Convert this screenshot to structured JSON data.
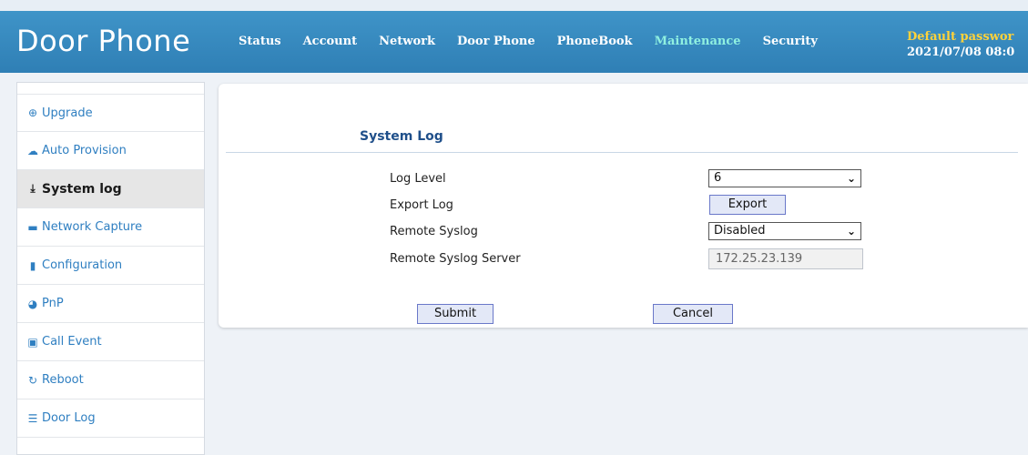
{
  "header": {
    "brand": "Door Phone",
    "nav": [
      {
        "label": "Status",
        "active": false
      },
      {
        "label": "Account",
        "active": false
      },
      {
        "label": "Network",
        "active": false
      },
      {
        "label": "Door Phone",
        "active": false
      },
      {
        "label": "PhoneBook",
        "active": false
      },
      {
        "label": "Maintenance",
        "active": true
      },
      {
        "label": "Security",
        "active": false
      }
    ],
    "status_warning": "Default passwor",
    "status_time": "2021/07/08 08:0"
  },
  "sidebar": {
    "items": [
      {
        "label": "Upgrade",
        "icon": "upgrade-icon",
        "glyph": "⊕",
        "active": false
      },
      {
        "label": "Auto Provision",
        "icon": "cloud-icon",
        "glyph": "☁",
        "active": false
      },
      {
        "label": "System log",
        "icon": "download-icon",
        "glyph": "⤓",
        "active": true
      },
      {
        "label": "Network Capture",
        "icon": "briefcase-icon",
        "glyph": "▬",
        "active": false
      },
      {
        "label": "Configuration",
        "icon": "file-icon",
        "glyph": "▮",
        "active": false
      },
      {
        "label": "PnP",
        "icon": "globe-icon",
        "glyph": "◕",
        "active": false
      },
      {
        "label": "Call Event",
        "icon": "image-icon",
        "glyph": "▣",
        "active": false
      },
      {
        "label": "Reboot",
        "icon": "refresh-icon",
        "glyph": "↻",
        "active": false
      },
      {
        "label": "Door Log",
        "icon": "list-icon",
        "glyph": "☰",
        "active": false
      }
    ]
  },
  "main": {
    "section_title": "System Log",
    "log_level_label": "Log Level",
    "log_level_value": "6",
    "export_log_label": "Export Log",
    "export_button": "Export",
    "remote_syslog_label": "Remote Syslog",
    "remote_syslog_value": "Disabled",
    "remote_server_label": "Remote Syslog Server",
    "remote_server_value": "172.25.23.139",
    "submit_button": "Submit",
    "cancel_button": "Cancel"
  },
  "colors": {
    "header_bg": "#3a8dc3",
    "active_nav": "#8ff0e0",
    "warning": "#ffd23a",
    "sidebar_link": "#2f7fc1",
    "section_title": "#1f4f8a"
  }
}
